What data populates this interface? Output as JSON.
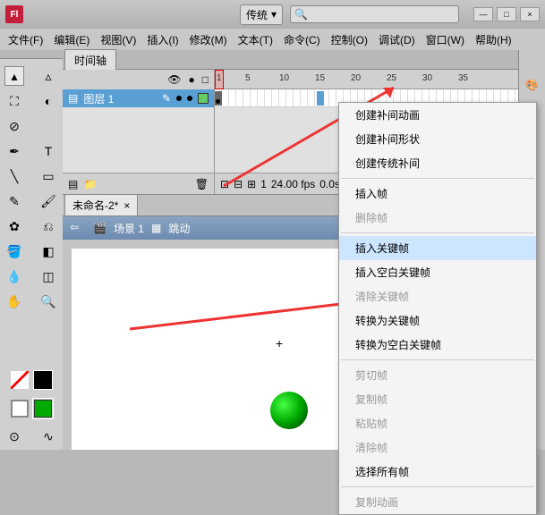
{
  "app": {
    "logo": "Fl",
    "dropdown": "传统",
    "search_placeholder": ""
  },
  "win": {
    "min": "—",
    "max": "□",
    "close": "×"
  },
  "menu": [
    "文件(F)",
    "编辑(E)",
    "视图(V)",
    "插入(I)",
    "修改(M)",
    "文本(T)",
    "命令(C)",
    "控制(O)",
    "调试(D)",
    "窗口(W)",
    "帮助(H)"
  ],
  "timeline": {
    "tab": "时间轴",
    "layer": "图层 1",
    "ticks": [
      "1",
      "5",
      "10",
      "15",
      "20",
      "25",
      "30",
      "35"
    ],
    "footer": {
      "frame": "1",
      "fps": "24.00 fps",
      "time": "0.0s"
    }
  },
  "doc": {
    "tab": "未命名-2*",
    "scene": "场景 1",
    "jump": "跳动"
  },
  "context": {
    "items": [
      {
        "t": "创建补间动画",
        "d": false
      },
      {
        "t": "创建补间形状",
        "d": false
      },
      {
        "t": "创建传统补间",
        "d": false
      },
      {
        "sep": true
      },
      {
        "t": "插入帧",
        "d": false
      },
      {
        "t": "删除帧",
        "d": true
      },
      {
        "sep": true
      },
      {
        "t": "插入关键帧",
        "d": false,
        "hl": true
      },
      {
        "t": "插入空白关键帧",
        "d": false
      },
      {
        "t": "清除关键帧",
        "d": true
      },
      {
        "t": "转换为关键帧",
        "d": false
      },
      {
        "t": "转换为空白关键帧",
        "d": false
      },
      {
        "sep": true
      },
      {
        "t": "剪切帧",
        "d": true
      },
      {
        "t": "复制帧",
        "d": true
      },
      {
        "t": "粘贴帧",
        "d": true
      },
      {
        "t": "清除帧",
        "d": true
      },
      {
        "t": "选择所有帧",
        "d": false
      },
      {
        "sep": true
      },
      {
        "t": "复制动画",
        "d": true
      }
    ]
  },
  "icons": {
    "search": "🔍",
    "eye": "👁",
    "lock": "●",
    "box": "□",
    "pencil": "✎",
    "page": "▤",
    "folder": "📁",
    "trash": "🗑",
    "arrow": "⇦",
    "clap": "🎬",
    "palette": "🎨"
  }
}
